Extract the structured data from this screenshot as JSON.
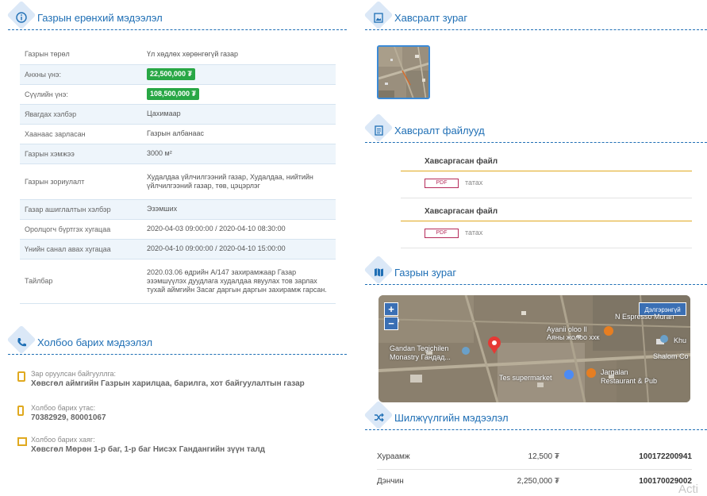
{
  "general": {
    "title": "Газрын ерөнхий мэдээлэл",
    "icon": "info-icon",
    "rows": [
      {
        "key": "Газрын төрөл",
        "value": "Үл хөдлөх хөрөнгөгүй газар"
      },
      {
        "key": "Анхны үнэ:",
        "value": "22,500,000 ₮",
        "badge": true
      },
      {
        "key": "Сүүлийн үнэ:",
        "value": "108,500,000 ₮",
        "badge": true
      },
      {
        "key": "Явагдах хэлбэр",
        "value": "Цахимаар"
      },
      {
        "key": "Хаанаас зарласан",
        "value": "Газрын албанаас"
      },
      {
        "key": "Газрын хэмжээ",
        "value": "3000 м²"
      },
      {
        "key": "Газрын зориулалт",
        "value": "Худалдаа үйлчилгээний газар, Худалдаа, нийтийн үйлчилгээний газар, төв, цэцэрлэг"
      },
      {
        "key": "Газар ашиглалтын хэлбэр",
        "value": "Эзэмших"
      },
      {
        "key": "Оролцогч бүртгэх хугацаа",
        "value": "2020-04-03 09:00:00 / 2020-04-10 08:30:00"
      },
      {
        "key": "Үнийн санал авах хугацаа",
        "value": "2020-04-10 09:00:00 / 2020-04-10 15:00:00"
      },
      {
        "key": "Тайлбар",
        "value": "2020.03.06 өдрийн А/147 захирамжаар Газар эзэмшүүлэх дуудлага худалдаа явуулах тов зарлах тухай аймгийн Засаг даргын даргын захирамж гарсан."
      }
    ]
  },
  "contact": {
    "title": "Холбоо барих мэдээлэл",
    "icon": "phone-icon",
    "items": [
      {
        "label": "Зар оруулсан байгууллга:",
        "value": "Хөвсгөл аймгийн Газрын харилцаа, барилга, хот байгуулалтын газар",
        "icon": "building-icon"
      },
      {
        "label": "Холбоо барих утас:",
        "value": "70382929, 80001067",
        "icon": "mobile-icon"
      },
      {
        "label": "Холбоо барих хаяг:",
        "value": "Хөвсгөл Мөрөн 1-р баг, 1-р баг Нисэх Гандангийн зүүн талд",
        "icon": "map-icon"
      }
    ]
  },
  "attachments_image": {
    "title": "Хавсралт зураг",
    "icon": "image-icon"
  },
  "attachments_files": {
    "title": "Хавсралт файлууд",
    "icon": "file-icon",
    "files": [
      {
        "name": "Хавсаргасан файл",
        "type": "PDF",
        "action": "татах"
      },
      {
        "name": "Хавсаргасан файл",
        "type": "PDF",
        "action": "татах"
      }
    ]
  },
  "land_map": {
    "title": "Газрын зураг",
    "icon": "map-icon",
    "zoom_in": "+",
    "zoom_out": "−",
    "expand": "Дэлгэрэнгүй",
    "labels": [
      "Ayanii oloo ll",
      "Аяны жолоо ххк",
      "Gandan Tegichilen",
      "Monastry Гандад...",
      "Tes supermarket",
      "Jargalan",
      "Restaurant & Pub",
      "Shalom Co",
      "N Espresso Muran",
      "Khu"
    ]
  },
  "transfer": {
    "title": "Шилжүүлгийн мэдээлэл",
    "icon": "shuffle-icon",
    "rows": [
      {
        "bank": "Хураамж",
        "amount": "12,500 ₮",
        "account": "100172200941"
      },
      {
        "bank": "Дэнчин",
        "amount": "2,250,000 ₮",
        "account": "100170029002"
      }
    ]
  },
  "watermark": "Acti",
  "colors": {
    "accent": "#1f6fb5",
    "badge": "#28a745",
    "file_line": "#e0a91f",
    "pdf": "#b52b5a"
  }
}
